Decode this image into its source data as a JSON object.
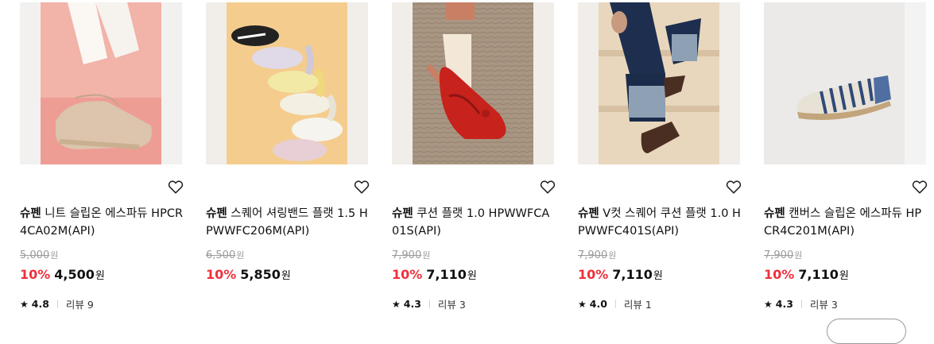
{
  "products": [
    {
      "brand": "슈펜",
      "name": "니트 슬립온 에스파듀 HPCR4CA02M(API)",
      "original_price": "5,000",
      "currency": "원",
      "discount": "10%",
      "sale_price": "4,500",
      "rating": "4.8",
      "review_label": "리뷰",
      "review_count": "9",
      "image": "knit-espadrille-photo"
    },
    {
      "brand": "슈펜",
      "name": "스퀘어 셔링밴드 플랫 1.5 HPWWFC206M(API)",
      "original_price": "6,500",
      "currency": "원",
      "discount": "10%",
      "sale_price": "5,850",
      "image": "square-shirring-flat-photo"
    },
    {
      "brand": "슈펜",
      "name": "쿠션 플랫 1.0 HPWWFCA01S(API)",
      "original_price": "7,900",
      "currency": "원",
      "discount": "10%",
      "sale_price": "7,110",
      "rating": "4.3",
      "review_label": "리뷰",
      "review_count": "3",
      "image": "red-cushion-flat-photo"
    },
    {
      "brand": "슈펜",
      "name": "V컷 스퀘어 쿠션 플랫 1.0 HPWWFC401S(API)",
      "original_price": "7,900",
      "currency": "원",
      "discount": "10%",
      "sale_price": "7,110",
      "rating": "4.0",
      "review_label": "리뷰",
      "review_count": "1",
      "image": "v-cut-flat-photo"
    },
    {
      "brand": "슈펜",
      "name": "캔버스 슬립온 에스파듀 HPCR4C201M(API)",
      "original_price": "7,900",
      "currency": "원",
      "discount": "10%",
      "sale_price": "7,110",
      "rating": "4.3",
      "review_label": "리뷰",
      "review_count": "3",
      "image": "canvas-stripe-espadrille-photo"
    }
  ],
  "colors": {
    "discount": "#f0303c",
    "muted": "#9a9a9a"
  }
}
